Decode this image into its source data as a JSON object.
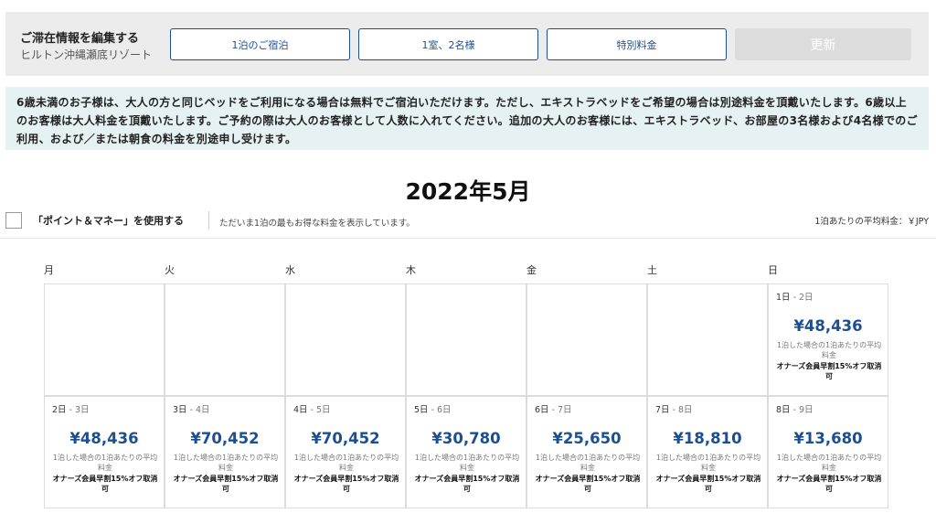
{
  "editbar": {
    "title": "ご滞在情報を編集する",
    "hotel": "ヒルトン沖縄瀬底リゾート",
    "nights_label": "1泊のご宿泊",
    "rooms_label": "1室、2名様",
    "rate_label": "特別料金",
    "update_label": "更新"
  },
  "notice": "6歳未満のお子様は、大人の方と同じベッドをご利用になる場合は無料でご宿泊いただけます。ただし、エキストラベッドをご希望の場合は別途料金を頂戴いたします。6歳以上のお客様は大人料金を頂戴いたします。ご予約の際は大人のお客様として人数に入れてください。追加の大人のお客様には、エキストラベッド、お部屋の3名様および4名様でのご利用、および／または朝食の料金を別途申し受けます。",
  "month": "2022年5月",
  "points": {
    "label": "「ポイント＆マネー」を使用する",
    "desc": "ただいま1泊の最もお得な料金を表示しています。",
    "avg_note": "1泊あたりの平均料金：￥JPY"
  },
  "weekdays": [
    "月",
    "火",
    "水",
    "木",
    "金",
    "土",
    "日"
  ],
  "days": [
    {
      "start": "1日",
      "end": "2日",
      "price": "¥48,436",
      "note": "1泊した場合の1泊あたりの平均料金",
      "rate": "オナーズ会員早割15%オフ取消可"
    },
    {
      "start": "2日",
      "end": "3日",
      "price": "¥48,436",
      "note": "1泊した場合の1泊あたりの平均料金",
      "rate": "オナーズ会員早割15%オフ取消可"
    },
    {
      "start": "3日",
      "end": "4日",
      "price": "¥70,452",
      "note": "1泊した場合の1泊あたりの平均料金",
      "rate": "オナーズ会員早割15%オフ取消可"
    },
    {
      "start": "4日",
      "end": "5日",
      "price": "¥70,452",
      "note": "1泊した場合の1泊あたりの平均料金",
      "rate": "オナーズ会員早割15%オフ取消可"
    },
    {
      "start": "5日",
      "end": "6日",
      "price": "¥30,780",
      "note": "1泊した場合の1泊あたりの平均料金",
      "rate": "オナーズ会員早割15%オフ取消可"
    },
    {
      "start": "6日",
      "end": "7日",
      "price": "¥25,650",
      "note": "1泊した場合の1泊あたりの平均料金",
      "rate": "オナーズ会員早割15%オフ取消可"
    },
    {
      "start": "7日",
      "end": "8日",
      "price": "¥18,810",
      "note": "1泊した場合の1泊あたりの平均料金",
      "rate": "オナーズ会員早割15%オフ取消可"
    },
    {
      "start": "8日",
      "end": "9日",
      "price": "¥13,680",
      "note": "1泊した場合の1泊あたりの平均料金",
      "rate": "オナーズ会員早割15%オフ取消可"
    }
  ]
}
